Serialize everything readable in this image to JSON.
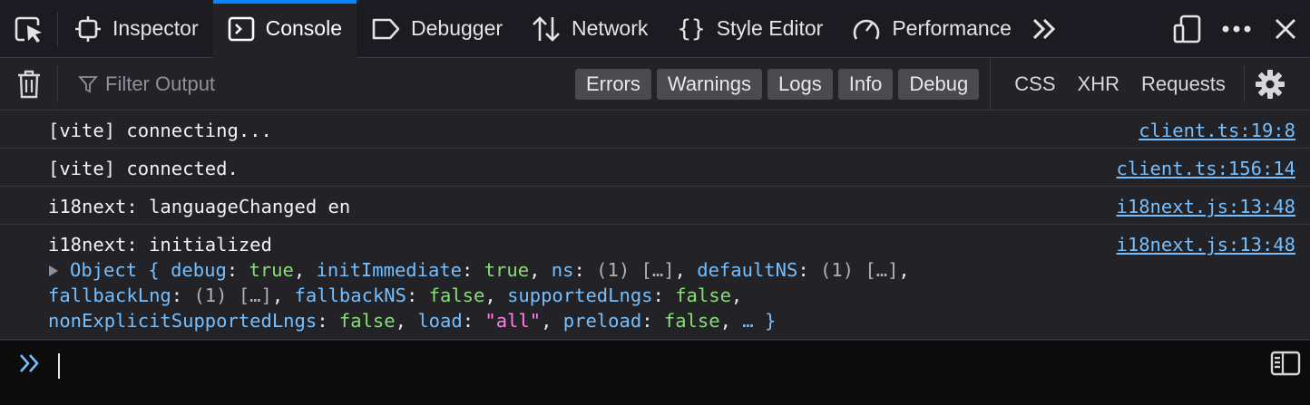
{
  "toolbar": {
    "tabs": [
      {
        "label": "Inspector",
        "icon": "inspector-icon",
        "selected": false
      },
      {
        "label": "Console",
        "icon": "console-icon",
        "selected": true
      },
      {
        "label": "Debugger",
        "icon": "debugger-icon",
        "selected": false
      },
      {
        "label": "Network",
        "icon": "network-icon",
        "selected": false
      },
      {
        "label": "Style Editor",
        "icon": "style-editor-icon",
        "selected": false
      },
      {
        "label": "Performance",
        "icon": "performance-icon",
        "selected": false
      }
    ]
  },
  "filter": {
    "placeholder": "Filter Output",
    "levels": [
      "Errors",
      "Warnings",
      "Logs",
      "Info",
      "Debug"
    ],
    "types": [
      "CSS",
      "XHR",
      "Requests"
    ]
  },
  "messages": [
    {
      "text": "[vite] connecting...",
      "source": "client.ts:19:8"
    },
    {
      "text": "[vite] connected.",
      "source": "client.ts:156:14"
    },
    {
      "text": "i18next: languageChanged en",
      "source": "i18next.js:13:48"
    },
    {
      "text": "i18next: initialized",
      "source": "i18next.js:13:48"
    }
  ],
  "object": {
    "label": "Object",
    "open": "{",
    "close": "… }",
    "props": [
      {
        "key": "debug",
        "value": "true",
        "kind": "bool"
      },
      {
        "key": "initImmediate",
        "value": "true",
        "kind": "bool"
      },
      {
        "key": "ns",
        "value": "(1) […]",
        "kind": "arr"
      },
      {
        "key": "defaultNS",
        "value": "(1) […]",
        "kind": "arr"
      },
      {
        "key": "fallbackLng",
        "value": "(1) […]",
        "kind": "arr"
      },
      {
        "key": "fallbackNS",
        "value": "false",
        "kind": "bool"
      },
      {
        "key": "supportedLngs",
        "value": "false",
        "kind": "bool"
      },
      {
        "key": "nonExplicitSupportedLngs",
        "value": "false",
        "kind": "bool"
      },
      {
        "key": "load",
        "value": "\"all\"",
        "kind": "str"
      },
      {
        "key": "preload",
        "value": "false",
        "kind": "bool"
      }
    ]
  },
  "colors": {
    "accent": "#0a84ff",
    "link": "#75bfff",
    "bool": "#86de74",
    "string": "#ff7de9"
  }
}
